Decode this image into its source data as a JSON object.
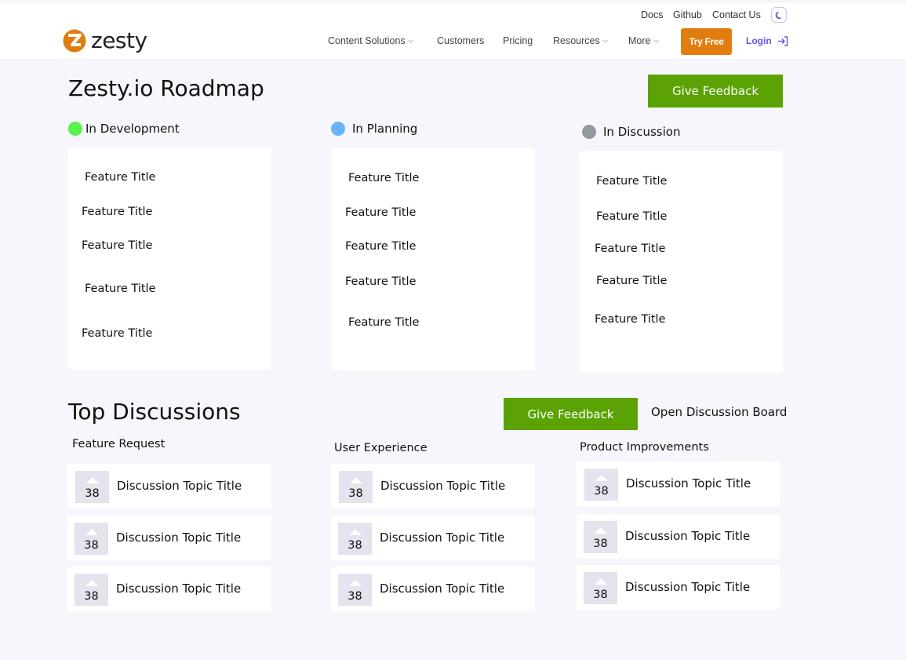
{
  "header": {
    "logo_text": "zesty",
    "utility_links": [
      "Docs",
      "Github",
      "Contact Us"
    ],
    "theme_toggle_icon": "moon-icon",
    "nav": [
      "Content Solutions",
      "Customers",
      "Pricing",
      "Resources",
      "More"
    ],
    "try_free": "Try Free",
    "login": "Login",
    "brand_colors": {
      "orange": "#e07d0e",
      "purple": "#6a52e6"
    }
  },
  "roadmap": {
    "title": "Zesty.io Roadmap",
    "feedback_button": "Give Feedback",
    "accent_green": "#5ba304",
    "columns": [
      {
        "status": "In Development",
        "color": "#5cf04a",
        "features": [
          "Feature Title",
          "Feature Title",
          "Feature Title",
          "Feature Title",
          "Feature Title"
        ]
      },
      {
        "status": "In Planning",
        "color": "#6cb3f5",
        "features": [
          "Feature Title",
          "Feature Title",
          "Feature Title",
          "Feature Title",
          "Feature Title"
        ]
      },
      {
        "status": "In Discussion",
        "color": "#919aa1",
        "features": [
          "Feature Title",
          "Feature Title",
          "Feature Title",
          "Feature Title",
          "Feature Title"
        ]
      }
    ]
  },
  "discussions": {
    "title": "Top Discussions",
    "feedback_button": "Give Feedback",
    "open_board": "Open Discussion Board",
    "categories": [
      {
        "label": "Feature Request",
        "items": [
          {
            "votes": "38",
            "title": "Discussion Topic Title"
          },
          {
            "votes": "38",
            "title": "Discussion Topic Title"
          },
          {
            "votes": "38",
            "title": "Discussion Topic Title"
          }
        ]
      },
      {
        "label": "User Experience",
        "items": [
          {
            "votes": "38",
            "title": "Discussion Topic Title"
          },
          {
            "votes": "38",
            "title": "Discussion Topic Title"
          },
          {
            "votes": "38",
            "title": "Discussion Topic Title"
          }
        ]
      },
      {
        "label": "Product Improvements",
        "items": [
          {
            "votes": "38",
            "title": "Discussion Topic Title"
          },
          {
            "votes": "38",
            "title": "Discussion Topic Title"
          },
          {
            "votes": "38",
            "title": "Discussion Topic Title"
          }
        ]
      }
    ]
  }
}
